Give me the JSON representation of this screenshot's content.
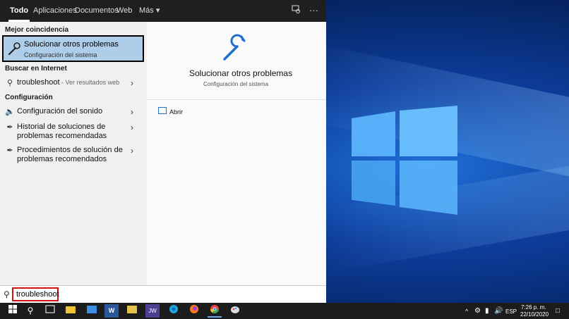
{
  "tabs": {
    "items": [
      "Todo",
      "Aplicaciones",
      "Documentos",
      "Web",
      "Más ▾"
    ],
    "active": "Todo",
    "icons": [
      "feedback-icon",
      "more-dots-icon"
    ],
    "more_dots": "···"
  },
  "left": {
    "section_best": "Mejor coincidencia",
    "best": {
      "title": "Solucionar otros problemas",
      "subtitle": "Configuración del sistema"
    },
    "section_web": "Buscar en Internet",
    "web": {
      "query": "troubleshoot",
      "suffix": " - Ver resultados web"
    },
    "section_config": "Configuración",
    "config_items": [
      "Configuración del sonido",
      "Historial de soluciones de problemas recomendadas",
      "Procedimientos de solución de problemas recomendados"
    ]
  },
  "right": {
    "title": "Solucionar otros problemas",
    "subtitle": "Configuración del sistema",
    "open_label": "Abrir"
  },
  "search": {
    "value": "troubleshoot"
  },
  "taskbar": {
    "apps": [
      "start-icon",
      "search-icon",
      "task-view-icon",
      "file-explorer-icon",
      "mail-icon",
      "word-icon",
      "folder-app-icon",
      "jw-icon",
      "edge-icon",
      "firefox-icon",
      "chrome-icon",
      "paint-icon"
    ],
    "jw_label": "JW",
    "word_label": "W"
  },
  "tray": {
    "lang": "ESP",
    "time": "7:26 p. m.",
    "date": "22/10/2020"
  },
  "colors": {
    "accent": "#aecde9",
    "highlight_border": "#000000",
    "annotation_red": "#d01010",
    "icon_blue": "#1e6fd0"
  }
}
